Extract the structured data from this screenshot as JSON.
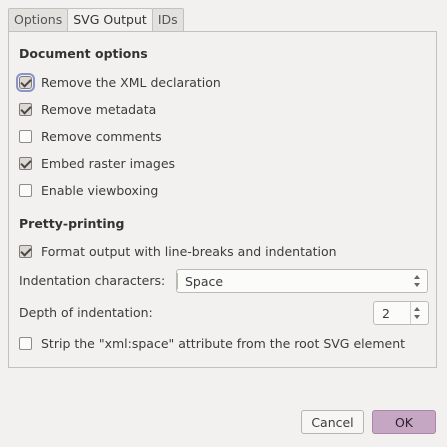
{
  "tabs": [
    {
      "label": "Options"
    },
    {
      "label": "SVG Output"
    },
    {
      "label": "IDs"
    }
  ],
  "document_options": {
    "heading": "Document options",
    "items": [
      {
        "label": "Remove the XML declaration",
        "checked": true
      },
      {
        "label": "Remove metadata",
        "checked": true
      },
      {
        "label": "Remove comments",
        "checked": false
      },
      {
        "label": "Embed raster images",
        "checked": true
      },
      {
        "label": "Enable viewboxing",
        "checked": false
      }
    ]
  },
  "pretty_printing": {
    "heading": "Pretty-printing",
    "format_label": "Format output with line-breaks and indentation",
    "format_checked": true,
    "indent_chars_label": "Indentation characters:",
    "indent_chars_value": "Space",
    "depth_label": "Depth of indentation:",
    "depth_value": "2",
    "strip_label": "Strip the \"xml:space\" attribute from the root SVG element",
    "strip_checked": false
  },
  "buttons": {
    "cancel": "Cancel",
    "ok": "OK"
  }
}
